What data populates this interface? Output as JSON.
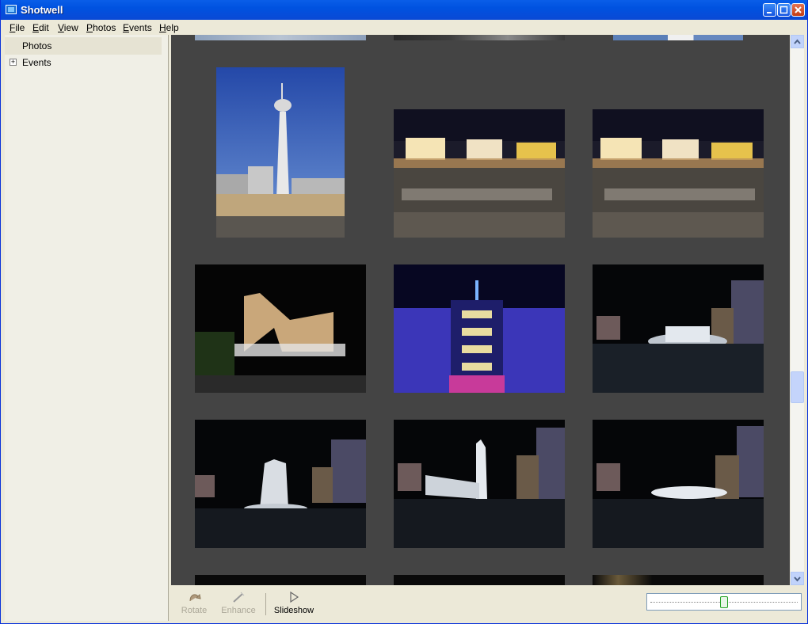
{
  "window": {
    "title": "Shotwell"
  },
  "menu": [
    {
      "label": "File",
      "mnemonic": "F",
      "rest": "ile"
    },
    {
      "label": "Edit",
      "mnemonic": "E",
      "rest": "dit"
    },
    {
      "label": "View",
      "mnemonic": "V",
      "rest": "iew"
    },
    {
      "label": "Photos",
      "mnemonic": "P",
      "rest": "hotos"
    },
    {
      "label": "Events",
      "mnemonic": "E",
      "rest": "vents"
    },
    {
      "label": "Help",
      "mnemonic": "H",
      "rest": "elp"
    }
  ],
  "sidebar": {
    "items": [
      {
        "label": "Photos",
        "selected": true
      },
      {
        "label": "Events",
        "expander": "+"
      }
    ]
  },
  "toolbar": {
    "rotate": "Rotate",
    "enhance": "Enhance",
    "slideshow": "Slideshow"
  },
  "zoom": {
    "level": 0.5
  },
  "colors": {
    "viewer_bg": "#444444",
    "titlebar": "#0052e0",
    "sidebar_bg": "#f0efe6"
  }
}
